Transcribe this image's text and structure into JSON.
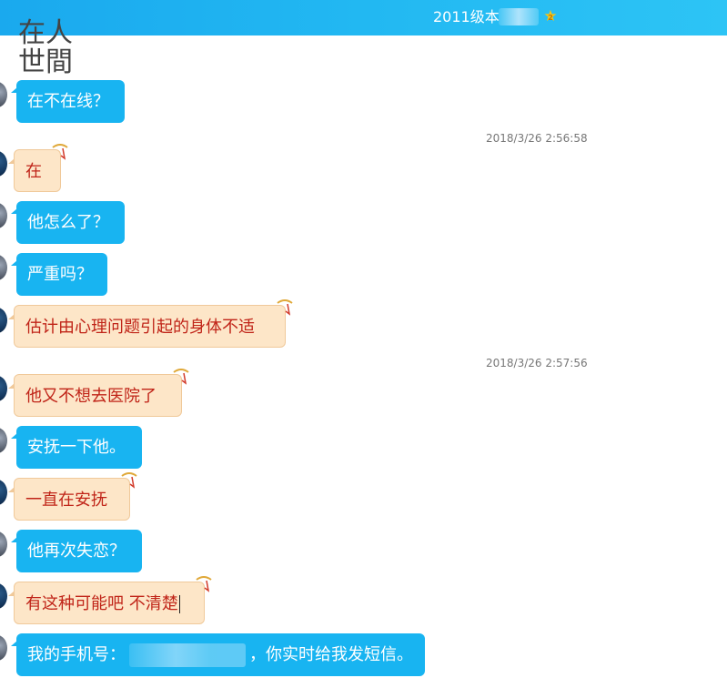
{
  "header": {
    "title": "2011级本",
    "badge": "2"
  },
  "watermark": {
    "line1": "在人",
    "line2": "世間"
  },
  "messages": [
    {
      "text": "在不在线？"
    },
    {
      "timestamp": "2018/3/26 2:56:58"
    },
    {
      "text": "在"
    },
    {
      "text": "他怎么了？"
    },
    {
      "text": "严重吗？"
    },
    {
      "text": "估计由心理问题引起的身体不适"
    },
    {
      "timestamp": "2018/3/26 2:57:56"
    },
    {
      "text": "他又不想去医院了"
    },
    {
      "text": "安抚一下他。"
    },
    {
      "text": "一直在安抚"
    },
    {
      "text": "他再次失恋？"
    },
    {
      "text": "有这种可能吧 不清楚"
    },
    {
      "text_before": "我的手机号：",
      "text_after": "，你实时给我发短信。"
    }
  ],
  "colors": {
    "header": "#1fb2ef",
    "sent_bubble": "#18b4f1",
    "received_bubble": "#fde6c8",
    "received_text": "#c02418"
  }
}
